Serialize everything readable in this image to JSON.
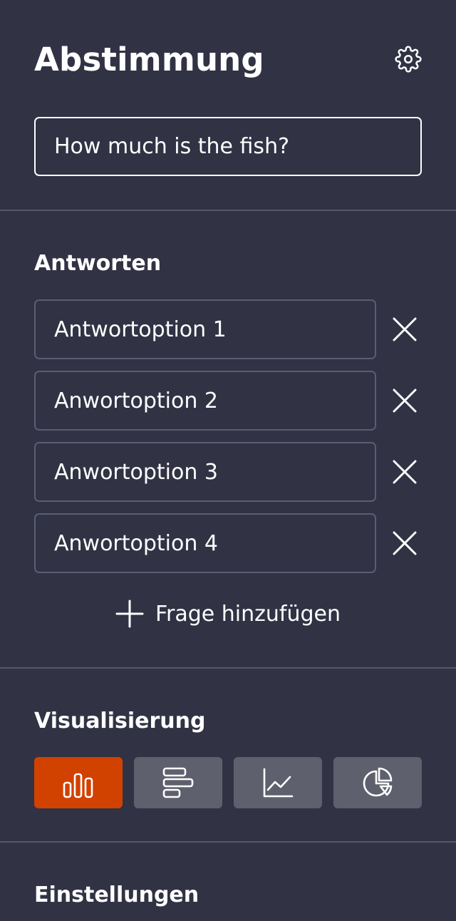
{
  "header": {
    "title": "Abstimmung",
    "settings_icon": "gear-icon"
  },
  "question": {
    "value": "How much is the fish?"
  },
  "answers": {
    "heading": "Antworten",
    "items": [
      {
        "value": "Antwortoption 1"
      },
      {
        "value": "Anwortoption 2"
      },
      {
        "value": "Anwortoption 3"
      },
      {
        "value": "Anwortoption 4"
      }
    ],
    "remove_icon": "close-icon",
    "add_label": "Frage hinzufügen",
    "add_icon": "plus-icon"
  },
  "visualization": {
    "heading": "Visualisierung",
    "options": [
      {
        "icon": "bar-chart-icon",
        "selected": true
      },
      {
        "icon": "horizontal-bar-chart-icon",
        "selected": false
      },
      {
        "icon": "line-chart-icon",
        "selected": false
      },
      {
        "icon": "pie-chart-icon",
        "selected": false
      }
    ]
  },
  "settings": {
    "heading": "Einstellungen"
  },
  "colors": {
    "background": "#313244",
    "accent": "#d14100",
    "button": "#5f606e",
    "divider": "#55576a"
  }
}
